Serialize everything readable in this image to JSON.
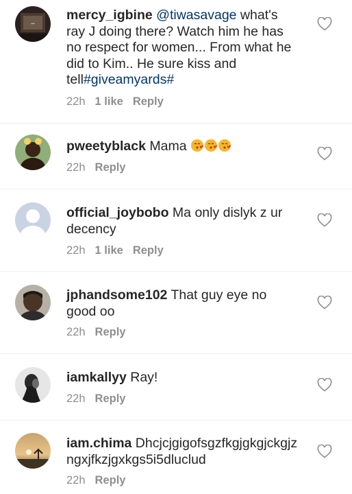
{
  "comments": [
    {
      "username": "mercy_igbine",
      "mention": "@tiwasavage",
      "text": " what's ray J  doing there?  Watch him he has no respect for women... From what he did to Kim.. He sure kiss and tell",
      "hashtag": "#giveamyards#",
      "time": "22h",
      "likes": "1 like",
      "reply": "Reply",
      "avatar_color": "#3a2a22"
    },
    {
      "username": "pweetyblack",
      "text": " Mama",
      "emoji": "kissing-face-with-heart",
      "time": "22h",
      "reply": "Reply",
      "avatar_color": "#6a8f5a"
    },
    {
      "username": "official_joybobo",
      "text": " Ma only dislyk z ur decency",
      "time": "22h",
      "likes": "1 like",
      "reply": "Reply",
      "avatar_color": "#c9d3e3"
    },
    {
      "username": "jphandsome102",
      "text": " That guy eye no good oo",
      "time": "22h",
      "reply": "Reply",
      "avatar_color": "#5a4a3a"
    },
    {
      "username": "iamkallyy",
      "text": " Ray!",
      "time": "22h",
      "reply": "Reply",
      "avatar_color": "#d8d8d8"
    },
    {
      "username": "iam.chima",
      "text": " Dhcjcjgigofsgzfkgjgkgjckgjz ngxjfkzjgxkgs5i5dluclud",
      "time": "22h",
      "reply": "Reply",
      "avatar_color": "#d7a56a"
    }
  ],
  "icons": {
    "like": "heart-outline-icon"
  }
}
